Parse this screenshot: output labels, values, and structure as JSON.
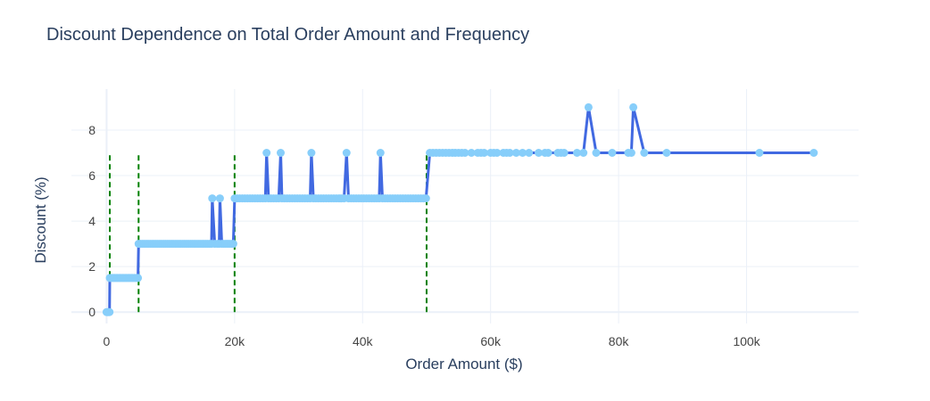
{
  "chart_data": {
    "type": "line",
    "title": "Discount Dependence on Total Order Amount and Frequency",
    "xlabel": "Order Amount ($)",
    "ylabel": "Discount (%)",
    "xlim": [
      -5500,
      117500
    ],
    "ylim": [
      -0.5,
      9.8
    ],
    "x_ticks": [
      0,
      20000,
      40000,
      60000,
      80000,
      100000
    ],
    "x_tick_labels": [
      "0",
      "20k",
      "40k",
      "60k",
      "80k",
      "100k"
    ],
    "y_ticks": [
      0,
      2,
      4,
      6,
      8
    ],
    "y_tick_labels": [
      "0",
      "2",
      "4",
      "6",
      "8"
    ],
    "grid": true,
    "thresholds": [
      500,
      5000,
      20000,
      50000
    ],
    "threshold_range": [
      0,
      7
    ],
    "series": [
      {
        "line_color": "#4169e1",
        "marker_color": "#87cefa",
        "x": [
          0,
          150,
          300,
          450,
          500,
          700,
          900,
          1100,
          1300,
          1500,
          1700,
          1900,
          2100,
          2300,
          2500,
          2700,
          2900,
          3100,
          3300,
          3500,
          3700,
          3900,
          4100,
          4300,
          4500,
          4700,
          4900,
          5000,
          5300,
          5600,
          5900,
          6200,
          6500,
          6800,
          7100,
          7400,
          7700,
          8000,
          8300,
          8600,
          8900,
          9200,
          9500,
          9800,
          10100,
          10400,
          10700,
          11000,
          11300,
          11600,
          11900,
          12200,
          12500,
          12800,
          13100,
          13400,
          13700,
          14000,
          14300,
          14600,
          14900,
          15200,
          15500,
          15800,
          16100,
          16400,
          16500,
          16900,
          17300,
          17600,
          17700,
          18000,
          18300,
          18600,
          18900,
          19200,
          19500,
          19800,
          20000,
          20400,
          20800,
          21200,
          21600,
          22000,
          22400,
          22800,
          23200,
          23600,
          24000,
          24400,
          24800,
          25000,
          25300,
          25700,
          26100,
          26500,
          26900,
          27200,
          27400,
          27800,
          28200,
          28600,
          29000,
          29400,
          29800,
          30200,
          30600,
          31000,
          31400,
          31800,
          32000,
          32300,
          32700,
          33100,
          33500,
          33900,
          34300,
          34700,
          35100,
          35500,
          35900,
          36300,
          36700,
          37100,
          37500,
          37800,
          38200,
          38600,
          39000,
          39400,
          39800,
          40200,
          40600,
          41000,
          41400,
          41800,
          42200,
          42600,
          42800,
          43100,
          43500,
          43900,
          44300,
          44700,
          45100,
          45500,
          45900,
          46300,
          46700,
          47100,
          47500,
          47900,
          48300,
          48700,
          49100,
          49500,
          49900,
          50500,
          51000,
          51500,
          52000,
          52500,
          53000,
          53500,
          54000,
          54500,
          55000,
          55500,
          56000,
          57000,
          58000,
          58500,
          59000,
          60000,
          60500,
          61000,
          62000,
          62500,
          63000,
          64000,
          65000,
          66000,
          67500,
          68500,
          69000,
          70500,
          71000,
          71500,
          73500,
          74500,
          75300,
          76500,
          79000,
          81500,
          82000,
          82300,
          84000,
          87500,
          102000,
          110500
        ],
        "y": [
          0,
          0,
          0,
          0,
          1.5,
          1.5,
          1.5,
          1.5,
          1.5,
          1.5,
          1.5,
          1.5,
          1.5,
          1.5,
          1.5,
          1.5,
          1.5,
          1.5,
          1.5,
          1.5,
          1.5,
          1.5,
          1.5,
          1.5,
          1.5,
          1.5,
          1.5,
          3,
          3,
          3,
          3,
          3,
          3,
          3,
          3,
          3,
          3,
          3,
          3,
          3,
          3,
          3,
          3,
          3,
          3,
          3,
          3,
          3,
          3,
          3,
          3,
          3,
          3,
          3,
          3,
          3,
          3,
          3,
          3,
          3,
          3,
          3,
          3,
          3,
          3,
          3,
          5,
          3,
          3,
          3,
          5,
          3,
          3,
          3,
          3,
          3,
          3,
          3,
          5,
          5,
          5,
          5,
          5,
          5,
          5,
          5,
          5,
          5,
          5,
          5,
          5,
          7,
          5,
          5,
          5,
          5,
          5,
          7,
          5,
          5,
          5,
          5,
          5,
          5,
          5,
          5,
          5,
          5,
          5,
          5,
          7,
          5,
          5,
          5,
          5,
          5,
          5,
          5,
          5,
          5,
          5,
          5,
          5,
          5,
          7,
          5,
          5,
          5,
          5,
          5,
          5,
          5,
          5,
          5,
          5,
          5,
          5,
          5,
          7,
          5,
          5,
          5,
          5,
          5,
          5,
          5,
          5,
          5,
          5,
          5,
          5,
          5,
          5,
          5,
          5,
          5,
          5,
          7,
          7,
          7,
          7,
          7,
          7,
          7,
          7,
          7,
          7,
          7,
          7,
          7,
          7,
          7,
          7,
          7,
          7,
          7,
          7,
          7,
          7,
          7,
          7,
          7,
          7,
          7,
          7,
          7,
          7,
          7,
          7,
          7,
          9,
          7,
          7,
          7,
          7,
          9,
          7,
          7,
          7,
          7
        ]
      }
    ]
  },
  "colors": {
    "line": "#4169e1",
    "marker": "#87cefa",
    "threshold": "#008000",
    "grid": "#ebf0f8",
    "zeroline": "#ebf0f8",
    "text": "#2a3f5f",
    "tick_text": "#444444"
  }
}
